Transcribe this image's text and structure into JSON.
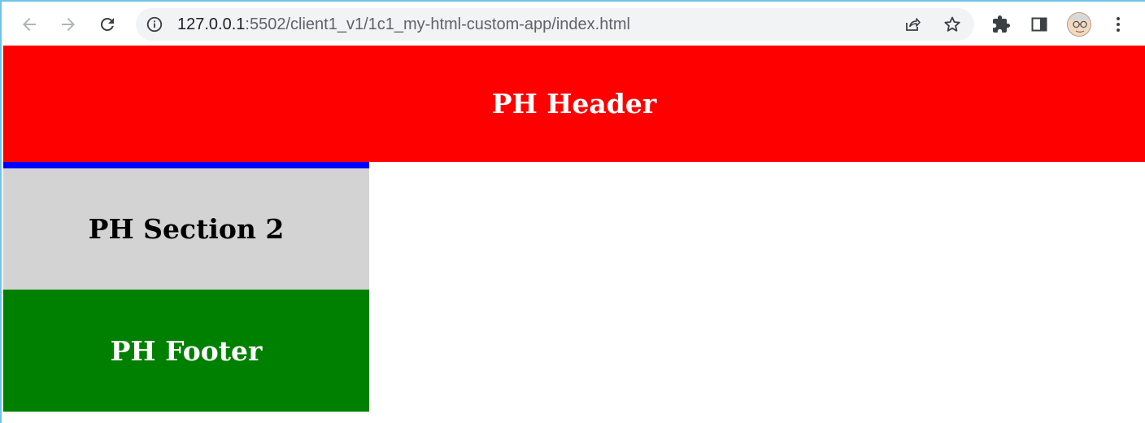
{
  "browser": {
    "url_host": "127.0.0.1",
    "url_rest": ":5502/client1_v1/1c1_my-html-custom-app/index.html",
    "icons": {
      "back": "arrow-left-icon",
      "forward": "arrow-right-icon",
      "reload": "reload-icon",
      "info": "info-icon",
      "share": "share-icon",
      "bookmark": "star-icon",
      "extensions": "puzzle-icon",
      "sidepanel": "side-panel-icon",
      "profile": "avatar",
      "menu": "kebab-menu-icon"
    }
  },
  "page": {
    "header_text": "PH Header",
    "section_text": "PH Section 2",
    "footer_text": "PH Footer"
  },
  "colors": {
    "header_bg": "#ff0000",
    "section_bg": "#d3d3d3",
    "section_border": "#0000ff",
    "footer_bg": "#008000",
    "window_border": "#6fc3e6"
  }
}
